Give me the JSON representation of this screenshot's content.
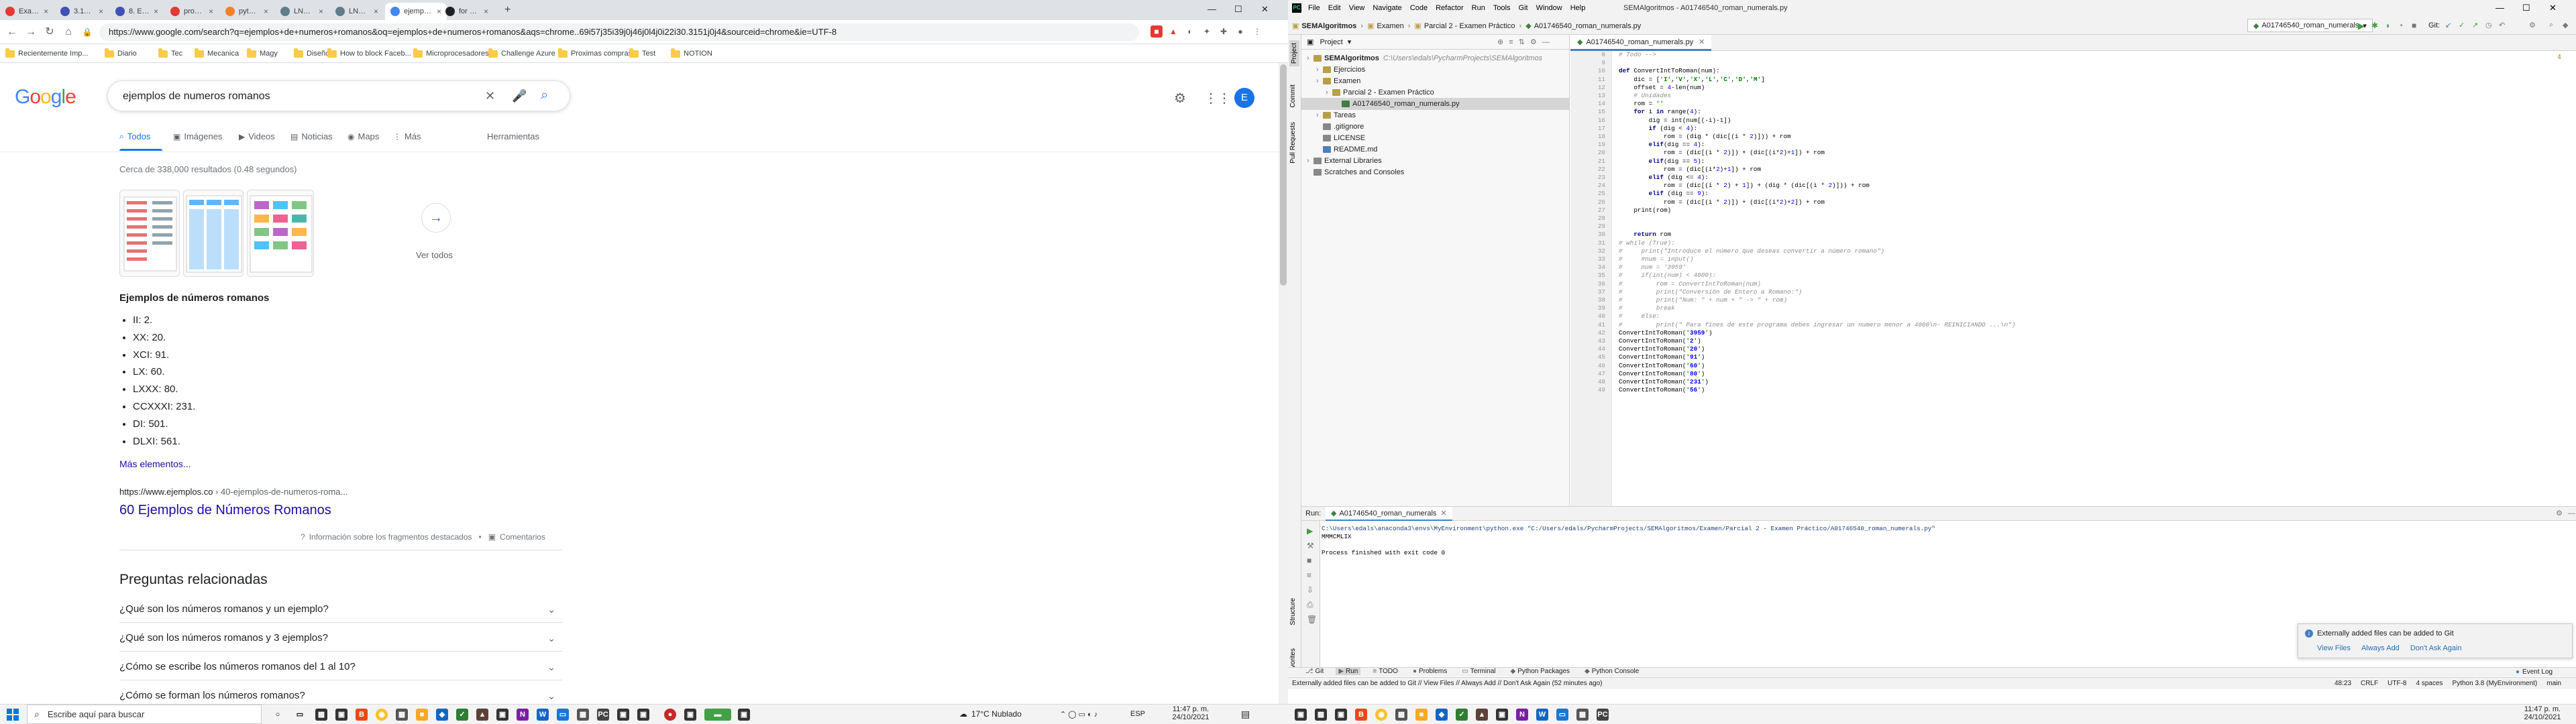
{
  "chrome": {
    "tabs": [
      {
        "title": "Examen - codigo",
        "color": "#e53935"
      },
      {
        "title": "3.11. Tipo diccionarios — Py",
        "color": "#3f51b5"
      },
      {
        "title": "8. Errors and Exceptions —",
        "color": "#3f51b5"
      },
      {
        "title": "programa que convierta en",
        "color": "#e53935"
      },
      {
        "title": "python — Programa básico",
        "color": "#f48024"
      },
      {
        "title": "LNKs.png (509×322)",
        "color": "#607d8b"
      },
      {
        "title": "LNKs.png (509×322)",
        "color": "#607d8b"
      },
      {
        "title": "ejemplos de numeros roma",
        "color": "#4285f4"
      },
      {
        "title": "for en Python - El bucle for",
        "color": "#202124"
      }
    ],
    "new_tab": "+",
    "url": "https://www.google.com/search?q=ejemplos+de+numeros+romanos&oq=ejemplos+de+numeros+romanos&aqs=chrome..69i57j35i39j0j46j0l4j0i22i30.3151j0j4&sourceid=chrome&ie=UTF-8",
    "bookmarks": [
      "Recientemente Imp...",
      "Diario",
      "Tec",
      "Mecanica",
      "Magy",
      "Diseño",
      "How to block Faceb...",
      "Microprocesadores",
      "Challenge Azure",
      "Proximas compras",
      "Test",
      "NOTION"
    ]
  },
  "google": {
    "logo": "Google",
    "query": "ejemplos de numeros romanos",
    "tabs": [
      "Todos",
      "Imágenes",
      "Videos",
      "Noticias",
      "Maps",
      "Más",
      "Herramientas"
    ],
    "stats": "Cerca de 338,000 resultados (0.48 segundos)",
    "see_all": "Ver todos",
    "snippet_title": "Ejemplos de números romanos",
    "snippet_items": [
      "II: 2.",
      "XX: 20.",
      "XCI: 91.",
      "LX: 60.",
      "LXXX: 80.",
      "CCXXXI: 231.",
      "DI: 501.",
      "DLXI: 561."
    ],
    "more_items": "Más elementos...",
    "result_domain": "https://www.ejemplos.co",
    "result_path": " › 40-ejemplos-de-numeros-roma...",
    "result_title": "60 Ejemplos de Números Romanos",
    "about_snippets": "Información sobre los fragmentos destacados",
    "feedback": "Comentarios",
    "paa_title": "Preguntas relacionadas",
    "paa": [
      "¿Qué son los números romanos y un ejemplo?",
      "¿Qué son los números romanos y 3 ejemplos?",
      "¿Cómo se escribe los números romanos del 1 al 10?",
      "¿Cómo se forman los números romanos?"
    ],
    "avatar": "E"
  },
  "taskbar_left": {
    "search_placeholder": "Escribe aquí para buscar",
    "weather": "17°C  Nublado",
    "lang": "ESP",
    "time": "11:47 p. m.",
    "date": "24/10/2021"
  },
  "pycharm": {
    "menu": [
      "File",
      "Edit",
      "View",
      "Navigate",
      "Code",
      "Refactor",
      "Run",
      "Tools",
      "Git",
      "Window",
      "Help"
    ],
    "window_title": "SEMAlgoritmos - A01746540_roman_numerals.py",
    "breadcrumbs": [
      "SEMAlgoritmos",
      "Examen",
      "Parcial 2 - Examen Práctico",
      "A01746540_roman_numerals.py"
    ],
    "run_config": "A01746540_roman_numerals",
    "git_label": "Git:",
    "project_label": "Project",
    "tree": [
      {
        "label": "SEMAlgoritmos",
        "extra": "C:\\Users\\edals\\PycharmProjects\\SEMAlgoritmos",
        "level": 0,
        "bold": true
      },
      {
        "label": "Ejercicios",
        "level": 1
      },
      {
        "label": "Examen",
        "level": 1
      },
      {
        "label": "Parcial 2 - Examen Práctico",
        "level": 2
      },
      {
        "label": "A01746540_roman_numerals.py",
        "level": 3,
        "selected": true
      },
      {
        "label": "Tareas",
        "level": 1
      },
      {
        "label": ".gitignore",
        "level": 1
      },
      {
        "label": "LICENSE",
        "level": 1
      },
      {
        "label": "README.md",
        "level": 1
      },
      {
        "label": "External Libraries",
        "level": 0
      },
      {
        "label": "Scratches and Consoles",
        "level": 0
      }
    ],
    "editor_tab": "A01746540_roman_numerals.py",
    "inspections": "16  14",
    "code_start_line": 8,
    "code": [
      "# Todo -->",
      "",
      "def ConvertIntToRoman(num):",
      "    dic = ['I','V','X','L','C','D','M']",
      "    offset = 4-len(num)",
      "    # Unidades",
      "    rom = ''",
      "    for i in range(4):",
      "        dig = int(num[(-i)-1])",
      "        if (dig < 4):",
      "            rom = (dig * (dic[(i * 2)])) + rom",
      "        elif(dig == 4):",
      "            rom = (dic[(i * 2)]) + (dic[(i*2)+1]) + rom",
      "        elif(dig == 5):",
      "            rom = (dic[(i*2)+1]) + rom",
      "        elif (dig <= 4):",
      "            rom = (dic[(i * 2) + 1]) + (dig * (dic[(i * 2)])) + rom",
      "        elif (dig == 9):",
      "            rom = (dic[(i * 2)]) + (dic[(i*2)+2]) + rom",
      "    print(rom)",
      "",
      "",
      "    return rom",
      "# while (True):",
      "#     print(\"Introduce el número que deseas convertir a número romano\")",
      "#     #num = input()",
      "#     num = '3959'",
      "#     if(int(num) < 4000):",
      "#         rom = ConvertIntToRoman(num)",
      "#         print(\"Conversión de Entero a Romano:\")",
      "#         print(\"Num: \" + num + \" -> \" + rom)",
      "#         break",
      "#     else:",
      "#         print(\" Para fines de este programa debes ingresar un numero menor a 4000\\n- REINICIANDO ...\\n\")",
      "ConvertIntToRoman('3959')",
      "ConvertIntToRoman('2')",
      "ConvertIntToRoman('20')",
      "ConvertIntToRoman('91')",
      "ConvertIntToRoman('60')",
      "ConvertIntToRoman('80')",
      "ConvertIntToRoman('231')",
      "ConvertIntToRoman('56')"
    ],
    "run_label": "Run:",
    "run_tab": "A01746540_roman_numerals",
    "run_output": [
      "C:\\Users\\edals\\anaconda3\\envs\\MyEnvironment\\python.exe \"C:/Users/edals/PycharmProjects/SEMAlgoritmos/Examen/Parcial 2 - Examen Práctico/A01746540_roman_numerals.py\"",
      "MMMCMLIX",
      "",
      "Process finished with exit code 0"
    ],
    "bottom_tabs": [
      "Git",
      "Run",
      "TODO",
      "Problems",
      "Terminal",
      "Python Packages",
      "Python Console"
    ],
    "event_log": "Event Log",
    "status_msg": "Externally added files can be added to Git // View Files // Always Add // Don't Ask Again (52 minutes ago)",
    "status_right": [
      "48:23",
      "CRLF",
      "UTF-8",
      "4 spaces",
      "Python 3.8 (MyEnvironment)",
      "main"
    ],
    "notification": {
      "title": "Externally added files can be added to Git",
      "actions": [
        "View Files",
        "Always Add",
        "Don't Ask Again"
      ]
    },
    "side_tabs_left": [
      "Project",
      "Commit",
      "Pull Requests",
      "Structure",
      "Favorites"
    ]
  },
  "taskbar_right": {
    "time": "11:47 p. m.",
    "date": "24/10/2021"
  }
}
